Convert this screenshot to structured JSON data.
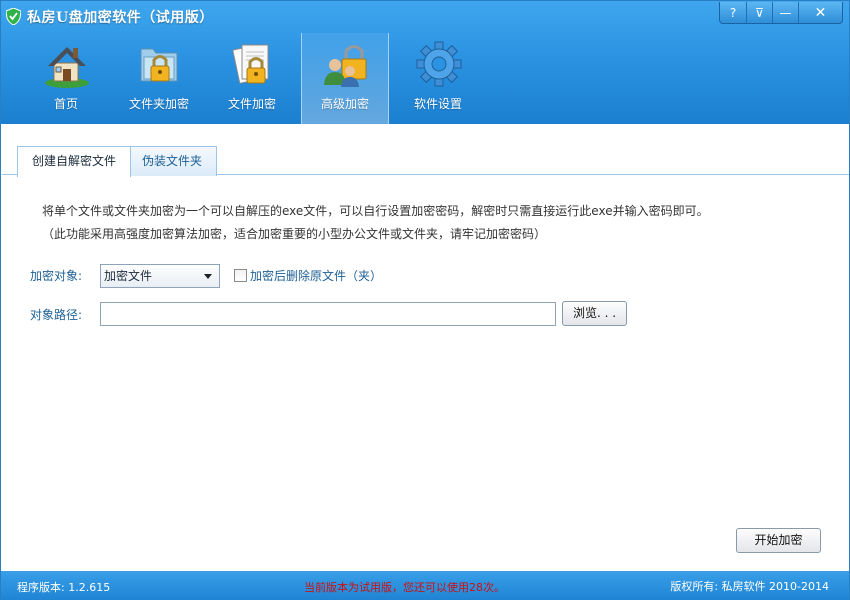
{
  "window": {
    "title": "私房U盘加密软件（试用版）",
    "controls": {
      "help": "?",
      "menu": "⊽",
      "minimize": "—",
      "close": "✕"
    }
  },
  "nav": {
    "items": [
      {
        "label": "首页",
        "icon": "home-icon"
      },
      {
        "label": "文件夹加密",
        "icon": "folder-lock-icon"
      },
      {
        "label": "文件加密",
        "icon": "file-lock-icon"
      },
      {
        "label": "高级加密",
        "icon": "advanced-lock-icon",
        "active": true
      },
      {
        "label": "软件设置",
        "icon": "gear-icon"
      }
    ]
  },
  "tabs": [
    {
      "label": "创建自解密文件",
      "active": true
    },
    {
      "label": "伪装文件夹",
      "active": false
    }
  ],
  "content": {
    "description_line1": "将单个文件或文件夹加密为一个可以自解压的exe文件，可以自行设置加密密码，解密时只需直接运行此exe并输入密码即可。",
    "description_line2": "（此功能采用高强度加密算法加密，适合加密重要的小型办公文件或文件夹，请牢记加密密码）",
    "target_label": "加密对象:",
    "target_value": "加密文件",
    "delete_original_label": "加密后删除原文件（夹）",
    "delete_original_checked": false,
    "path_label": "对象路径:",
    "path_value": "",
    "browse_label": "浏览. . .",
    "start_label": "开始加密"
  },
  "status": {
    "version": "程序版本: 1.2.615",
    "trial_notice": "当前版本为试用版，您还可以使用28次。",
    "copyright": "版权所有: 私房软件 2010-2014"
  },
  "colors": {
    "header_top": "#3fa6ee",
    "header_bottom": "#1c7fd0",
    "label_blue": "#1e5f95",
    "trial_red": "#cc1010"
  }
}
